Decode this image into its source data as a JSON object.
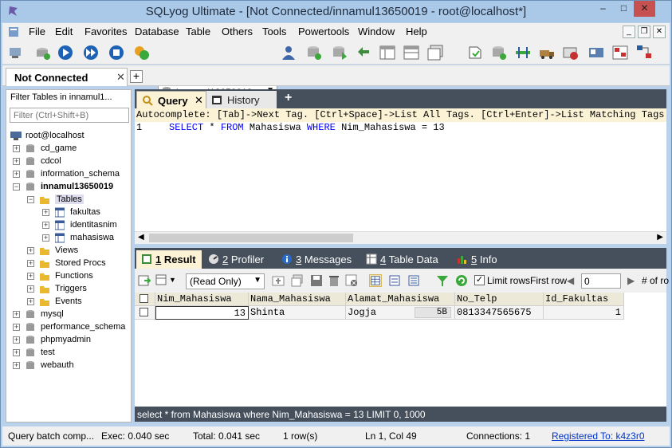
{
  "window": {
    "title": "SQLyog Ultimate - [Not Connected/innamul13650019 - root@localhost*]"
  },
  "menu": [
    "File",
    "Edit",
    "Favorites",
    "Database",
    "Table",
    "Others",
    "Tools",
    "Powertools",
    "Window",
    "Help"
  ],
  "toolbar": {
    "database": "innamul13650019"
  },
  "connection_tab": {
    "label": "Not Connected"
  },
  "object_browser": {
    "filter_label": "Filter Tables in innamul1...",
    "filter_placeholder": "Filter (Ctrl+Shift+B)",
    "root": "root@localhost",
    "databases": [
      "cd_game",
      "cdcol",
      "information_schema",
      "innamul13650019",
      "mysql",
      "performance_schema",
      "phpmyadmin",
      "test",
      "webauth"
    ],
    "active_db_children": [
      "Tables",
      "Views",
      "Stored Procs",
      "Functions",
      "Triggers",
      "Events"
    ],
    "tables": [
      "fakultas",
      "identitasnim",
      "mahasiswa"
    ]
  },
  "query_tabs": [
    "Query",
    "History"
  ],
  "autocomplete_hint": "Autocomplete: [Tab]->Next Tag. [Ctrl+Space]->List All Tags. [Ctrl+Enter]->List Matching Tags. [Ctrl+Shift+Space...",
  "editor": {
    "line": "1",
    "sql": {
      "k1": "SELECT",
      "t1": " * ",
      "k2": "FROM",
      "t2": " Mahasiswa ",
      "k3": "WHERE",
      "t3": " Nim_Mahasiswa = 13"
    }
  },
  "result_tabs": [
    {
      "num": "1",
      "label": "Result"
    },
    {
      "num": "2",
      "label": "Profiler"
    },
    {
      "num": "3",
      "label": "Messages"
    },
    {
      "num": "4",
      "label": "Table Data"
    },
    {
      "num": "5",
      "label": "Info"
    }
  ],
  "result_toolbar": {
    "mode": "(Read Only)",
    "limit_rows": "Limit rows",
    "first_row_label": "First row",
    "first_row_value": "0",
    "num_rows_label": "# of ro"
  },
  "grid": {
    "columns": [
      "Nim_Mahasiswa",
      "Nama_Mahasiswa",
      "Alamat_Mahasiswa",
      "No_Telp",
      "Id_Fakultas"
    ],
    "rows": [
      {
        "nim": "13",
        "nama": "Shinta",
        "alamat": "Jogja",
        "alamat_size": "5B",
        "telp": "0813347565675",
        "fak": "1"
      }
    ]
  },
  "sql_status": "select * from Mahasiswa where Nim_Mahasiswa = 13 LIMIT 0, 1000",
  "status": {
    "batch": "Query batch comp...",
    "exec": "Exec: 0.040 sec",
    "total": "Total: 0.041 sec",
    "rows": "1 row(s)",
    "pos": "Ln 1, Col 49",
    "connections": "Connections: 1",
    "registered": "Registered To: k4z3r0"
  },
  "colors": {
    "accent": "#45505c",
    "query_tab": "#fcf3d7",
    "title_bar": "#aac8e8"
  }
}
